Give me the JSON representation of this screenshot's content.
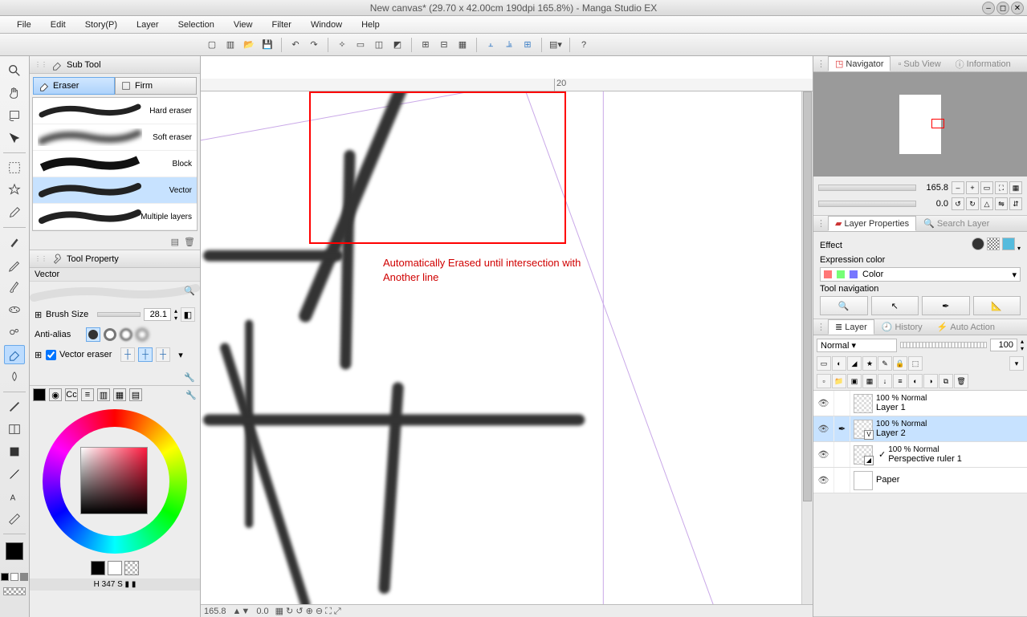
{
  "window": {
    "title": "New canvas* (29.70 x 42.00cm 190dpi 165.8%)  - Manga Studio EX"
  },
  "menu": [
    "File",
    "Edit",
    "Story(P)",
    "Layer",
    "Selection",
    "View",
    "Filter",
    "Window",
    "Help"
  ],
  "document_tab": {
    "label": "New canvas*"
  },
  "subtool": {
    "title": "Sub Tool",
    "groups": [
      {
        "label": "Eraser",
        "active": true
      },
      {
        "label": "Firm",
        "active": false
      }
    ],
    "items": [
      {
        "label": "Hard eraser"
      },
      {
        "label": "Soft eraser"
      },
      {
        "label": "Block"
      },
      {
        "label": "Vector",
        "selected": true
      },
      {
        "label": "Multiple layers"
      }
    ]
  },
  "toolproperty": {
    "title": "Tool Property",
    "selected_name": "Vector",
    "brush_size_label": "Brush Size",
    "brush_size_value": "28.1",
    "anti_alias_label": "Anti-alias",
    "vector_eraser_label": "Vector eraser"
  },
  "canvas": {
    "ruler_mark": "20",
    "zoom_status": "165.8",
    "pos_status": "0.0",
    "annotation": "Automatically Erased until intersection with Another line"
  },
  "navigator": {
    "tab_navigator": "Navigator",
    "tab_subview": "Sub View",
    "tab_info": "Information",
    "zoom_value": "165.8",
    "rotate_value": "0.0"
  },
  "layer_properties": {
    "tab_lp": "Layer Properties",
    "tab_sl": "Search Layer",
    "effect_label": "Effect",
    "expression_label": "Expression color",
    "expression_value": "Color",
    "toolnav_label": "Tool navigation"
  },
  "layers": {
    "tab_layer": "Layer",
    "tab_history": "History",
    "tab_autoaction": "Auto Action",
    "blend_mode": "Normal",
    "opacity": "100",
    "items": [
      {
        "opacity_mode": "100 %  Normal",
        "name": "Layer 1",
        "selected": false,
        "kind": "raster"
      },
      {
        "opacity_mode": "100 %  Normal",
        "name": "Layer 2",
        "selected": true,
        "kind": "vector"
      },
      {
        "opacity_mode": "100 %  Normal",
        "name": "Perspective ruler 1",
        "selected": false,
        "kind": "ruler"
      },
      {
        "opacity_mode": "",
        "name": "Paper",
        "selected": false,
        "kind": "paper"
      }
    ]
  },
  "color": {
    "readout": "H 347 S ▮ ▮"
  }
}
